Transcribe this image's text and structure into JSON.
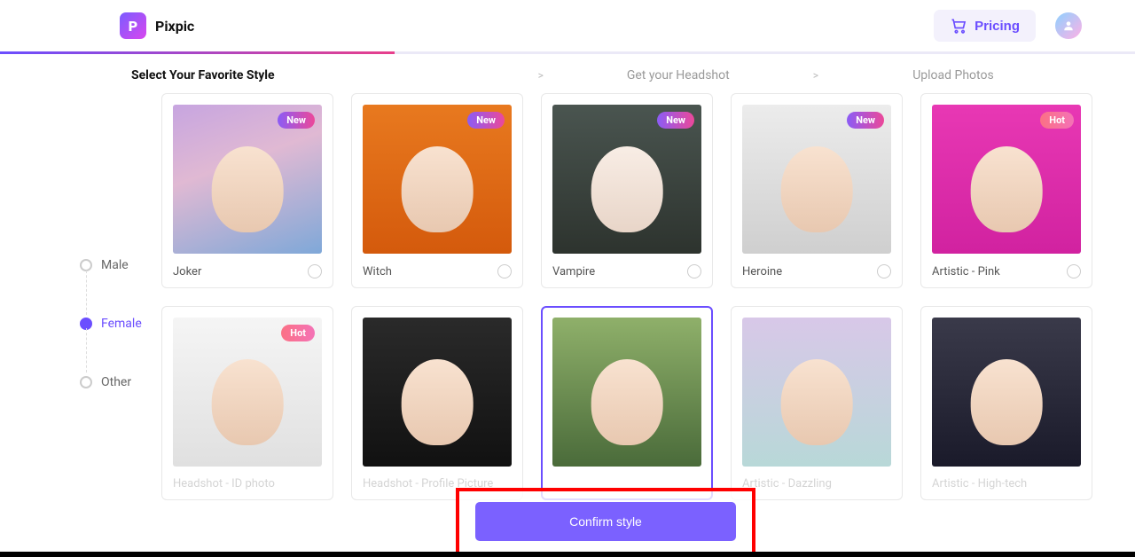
{
  "header": {
    "brand": "Pixpic",
    "pricing_label": "Pricing"
  },
  "breadcrumb": {
    "step1": "Select Your Favorite Style",
    "step2": "Get your Headshot",
    "step3": "Upload Photos",
    "sep": ">"
  },
  "sidebar": {
    "genders": [
      {
        "label": "Male",
        "active": false
      },
      {
        "label": "Female",
        "active": true
      },
      {
        "label": "Other",
        "active": false
      }
    ]
  },
  "badges": {
    "new": "New",
    "hot": "Hot"
  },
  "styles_row1": [
    {
      "label": "Joker",
      "badge": "new",
      "ph": "ph-joker"
    },
    {
      "label": "Witch",
      "badge": "new",
      "ph": "ph-witch"
    },
    {
      "label": "Vampire",
      "badge": "new",
      "ph": "ph-vampire"
    },
    {
      "label": "Heroine",
      "badge": "new",
      "ph": "ph-heroine"
    },
    {
      "label": "Artistic - Pink",
      "badge": "hot",
      "ph": "ph-pink"
    }
  ],
  "styles_row2": [
    {
      "label": "Headshot - ID photo",
      "badge": "hot",
      "ph": "ph-idphoto"
    },
    {
      "label": "Headshot - Profile Picture",
      "badge": null,
      "ph": "ph-profile"
    },
    {
      "label": "",
      "badge": null,
      "ph": "ph-selected",
      "selected": true
    },
    {
      "label": "Artistic - Dazzling",
      "badge": null,
      "ph": "ph-dazzling"
    },
    {
      "label": "Artistic - High-tech",
      "badge": null,
      "ph": "ph-hightech"
    }
  ],
  "confirm_label": "Confirm style"
}
